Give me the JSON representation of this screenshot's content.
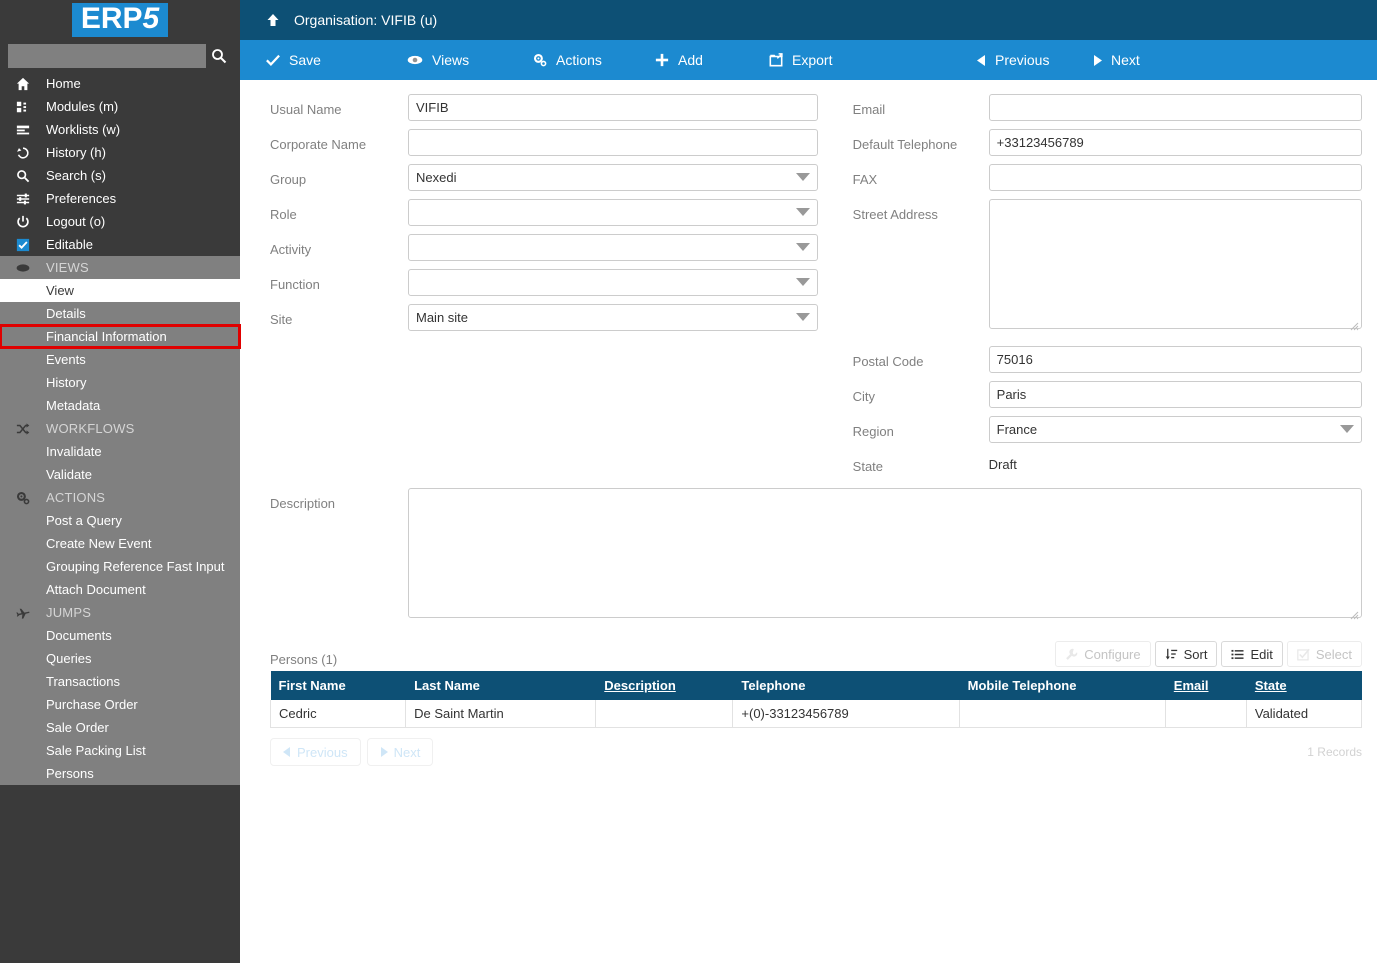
{
  "brand": {
    "logo_text_prefix": "ERP",
    "logo_text_suffix": "5"
  },
  "search": {
    "value": "",
    "placeholder": ""
  },
  "sidebar": {
    "main_items": [
      {
        "label": "Home",
        "icon": "home-icon"
      },
      {
        "label": "Modules (m)",
        "icon": "modules-icon"
      },
      {
        "label": "Worklists (w)",
        "icon": "worklists-icon"
      },
      {
        "label": "History (h)",
        "icon": "history-icon"
      },
      {
        "label": "Search (s)",
        "icon": "search-icon"
      },
      {
        "label": "Preferences",
        "icon": "preferences-icon"
      },
      {
        "label": "Logout (o)",
        "icon": "logout-icon"
      },
      {
        "label": "Editable",
        "icon": "checkbox-checked-icon"
      }
    ],
    "sections": [
      {
        "title": "VIEWS",
        "icon": "eye-icon",
        "items": [
          {
            "label": "View",
            "state": "current"
          },
          {
            "label": "Details",
            "state": "normal"
          },
          {
            "label": "Financial Information",
            "state": "highlighted"
          },
          {
            "label": "Events",
            "state": "normal"
          },
          {
            "label": "History",
            "state": "normal"
          },
          {
            "label": "Metadata",
            "state": "normal"
          }
        ]
      },
      {
        "title": "WORKFLOWS",
        "icon": "shuffle-icon",
        "items": [
          {
            "label": "Invalidate",
            "state": "normal"
          },
          {
            "label": "Validate",
            "state": "normal"
          }
        ]
      },
      {
        "title": "ACTIONS",
        "icon": "gears-icon",
        "items": [
          {
            "label": "Post a Query",
            "state": "normal"
          },
          {
            "label": "Create New Event",
            "state": "normal"
          },
          {
            "label": "Grouping Reference Fast Input",
            "state": "normal"
          },
          {
            "label": "Attach Document",
            "state": "normal"
          }
        ]
      },
      {
        "title": "JUMPS",
        "icon": "airplane-icon",
        "items": [
          {
            "label": "Documents",
            "state": "normal"
          },
          {
            "label": "Queries",
            "state": "normal"
          },
          {
            "label": "Transactions",
            "state": "normal"
          },
          {
            "label": "Purchase Order",
            "state": "normal"
          },
          {
            "label": "Sale Order",
            "state": "normal"
          },
          {
            "label": "Sale Packing List",
            "state": "normal"
          },
          {
            "label": "Persons",
            "state": "normal"
          }
        ]
      }
    ]
  },
  "header": {
    "title": "Organisation: VIFIB (u)",
    "up_icon": "up-arrow-icon"
  },
  "toolbar": {
    "items": [
      {
        "label": "Save",
        "icon": "check-icon"
      },
      {
        "label": "Views",
        "icon": "eye-icon"
      },
      {
        "label": "Actions",
        "icon": "gears-icon"
      },
      {
        "label": "Add",
        "icon": "plus-icon"
      },
      {
        "label": "Export",
        "icon": "export-icon"
      },
      {
        "label": "Previous",
        "icon": "triangle-left-icon"
      },
      {
        "label": "Next",
        "icon": "triangle-right-icon"
      }
    ]
  },
  "form": {
    "left": [
      {
        "label": "Usual Name",
        "type": "text",
        "value": "VIFIB",
        "name": "usual-name"
      },
      {
        "label": "Corporate Name",
        "type": "text",
        "value": "",
        "name": "corporate-name"
      },
      {
        "label": "Group",
        "type": "select",
        "value": "Nexedi",
        "name": "group"
      },
      {
        "label": "Role",
        "type": "select",
        "value": "",
        "name": "role"
      },
      {
        "label": "Activity",
        "type": "select",
        "value": "",
        "name": "activity"
      },
      {
        "label": "Function",
        "type": "select",
        "value": "",
        "name": "function"
      },
      {
        "label": "Site",
        "type": "select",
        "value": "Main site",
        "name": "site"
      }
    ],
    "right": [
      {
        "label": "Email",
        "type": "text",
        "value": "",
        "name": "email"
      },
      {
        "label": "Default Telephone",
        "type": "text",
        "value": "+33123456789",
        "name": "default-telephone"
      },
      {
        "label": "FAX",
        "type": "text",
        "value": "",
        "name": "fax"
      },
      {
        "label": "Street Address",
        "type": "textarea",
        "value": "",
        "name": "street-address"
      },
      {
        "label": "Postal Code",
        "type": "text",
        "value": "75016",
        "name": "postal-code"
      },
      {
        "label": "City",
        "type": "text",
        "value": "Paris",
        "name": "city"
      },
      {
        "label": "Region",
        "type": "select",
        "value": "France",
        "name": "region"
      },
      {
        "label": "State",
        "type": "static",
        "value": "Draft",
        "name": "state"
      }
    ],
    "description": {
      "label": "Description",
      "value": ""
    }
  },
  "listbox": {
    "title": "Persons (1)",
    "buttons": [
      {
        "label": "Configure",
        "icon": "wrench-icon",
        "enabled": false
      },
      {
        "label": "Sort",
        "icon": "sort-icon",
        "enabled": true
      },
      {
        "label": "Edit",
        "icon": "list-icon",
        "enabled": true
      },
      {
        "label": "Select",
        "icon": "checkbox-icon",
        "enabled": false
      }
    ],
    "columns": [
      {
        "label": "First Name",
        "sortable": false
      },
      {
        "label": "Last Name",
        "sortable": false
      },
      {
        "label": "Description",
        "sortable": true
      },
      {
        "label": "Telephone",
        "sortable": false
      },
      {
        "label": "Mobile Telephone",
        "sortable": false
      },
      {
        "label": "Email",
        "sortable": true
      },
      {
        "label": "State",
        "sortable": true
      }
    ],
    "rows": [
      [
        "Cedric",
        "De Saint Martin",
        "",
        "+(0)-33123456789",
        "",
        "",
        "Validated"
      ]
    ],
    "pagination": {
      "previous": "Previous",
      "next": "Next",
      "records": "1 Records"
    }
  },
  "colors": {
    "accent": "#1c8ad0",
    "header_dark": "#0d5075",
    "sidebar_dark": "#3a3a3a",
    "sidebar_grey": "#808080",
    "highlight_red": "#e00000"
  }
}
